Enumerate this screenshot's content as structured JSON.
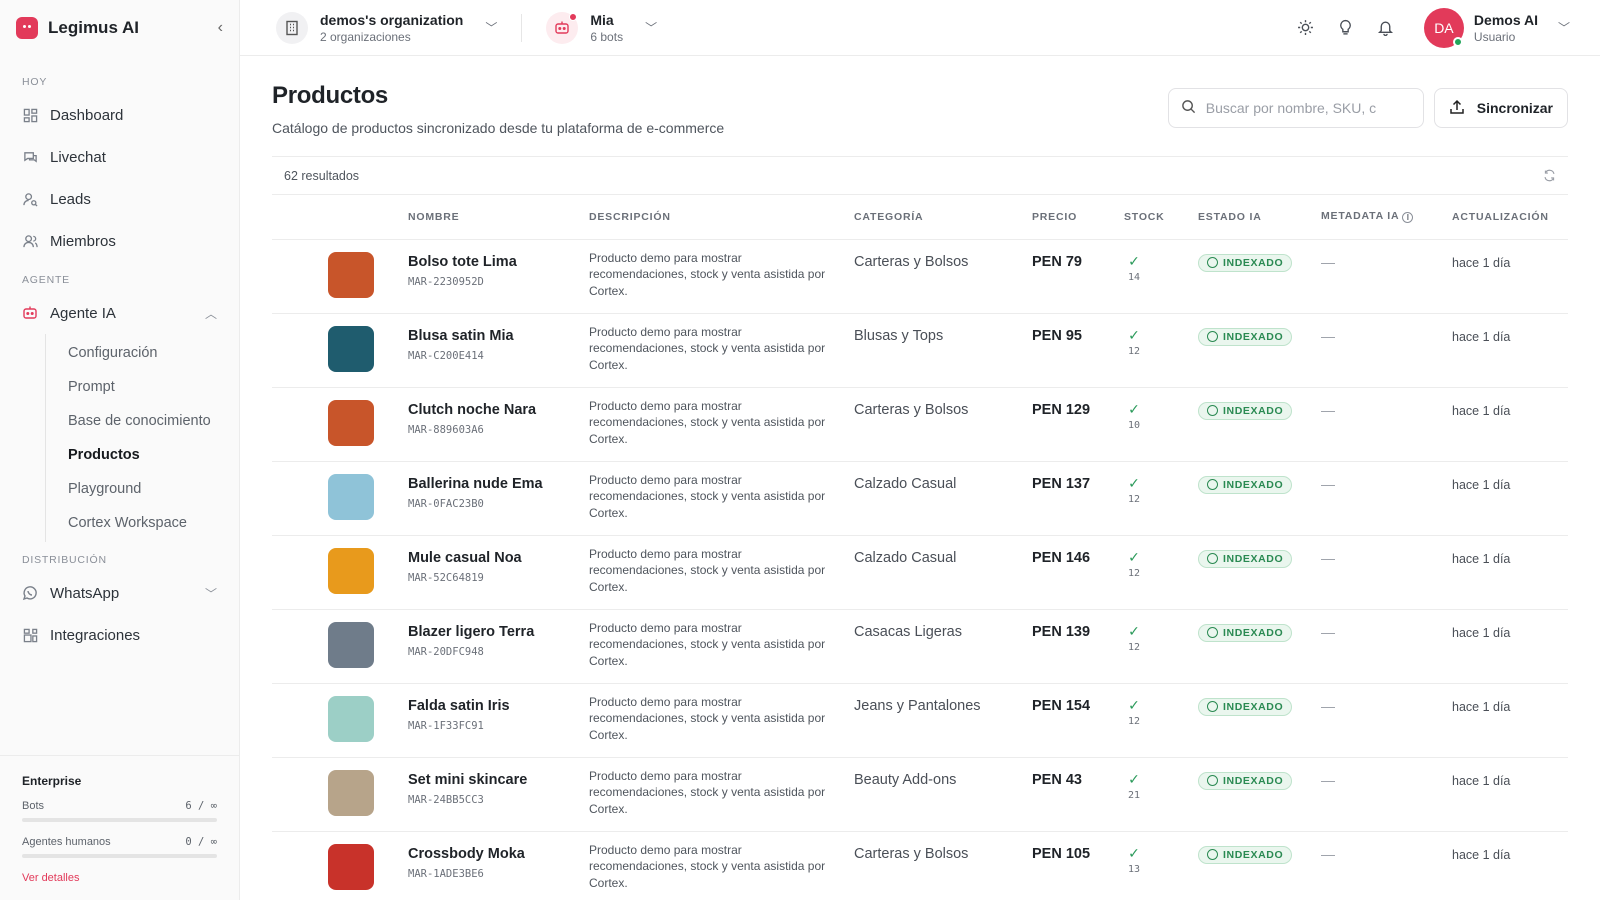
{
  "brand": {
    "name": "Legimus AI",
    "accent": "#e23a5a"
  },
  "sidebar": {
    "sections": {
      "hoy": "HOY",
      "agente": "AGENTE",
      "distribucion": "DISTRIBUCIÓN"
    },
    "items": {
      "dashboard": "Dashboard",
      "livechat": "Livechat",
      "leads": "Leads",
      "miembros": "Miembros",
      "agente_ia": "Agente IA",
      "whatsapp": "WhatsApp",
      "integraciones": "Integraciones"
    },
    "subitems": [
      "Configuración",
      "Prompt",
      "Base de conocimiento",
      "Productos",
      "Playground",
      "Cortex Workspace"
    ],
    "active_subitem": "Productos",
    "plan": {
      "title": "Enterprise",
      "bots_label": "Bots",
      "bots_value": "6 / ∞",
      "agents_label": "Agentes humanos",
      "agents_value": "0 / ∞",
      "details_link": "Ver detalles"
    }
  },
  "topbar": {
    "org": {
      "title": "demos's organization",
      "subtitle": "2 organizaciones"
    },
    "bot": {
      "title": "Mia",
      "subtitle": "6 bots"
    },
    "user": {
      "initials": "DA",
      "name": "Demos AI",
      "role": "Usuario"
    }
  },
  "page": {
    "title": "Productos",
    "subtitle": "Catálogo de productos sincronizado desde tu plataforma de e-commerce",
    "search_placeholder": "Buscar por nombre, SKU, c",
    "sync_label": "Sincronizar",
    "results": "62 resultados"
  },
  "table": {
    "headers": {
      "nombre": "NOMBRE",
      "descripcion": "DESCRIPCIÓN",
      "categoria": "CATEGORÍA",
      "precio": "PRECIO",
      "stock": "STOCK",
      "estado": "ESTADO IA",
      "metadata": "METADATA IA",
      "actualizacion": "ACTUALIZACIÓN"
    },
    "rows": [
      {
        "name": "Bolso tote Lima",
        "sku": "MAR-2230952D",
        "desc": "Producto demo para mostrar recomendaciones, stock y venta asistida por Cortex.",
        "category": "Carteras y Bolsos",
        "price": "PEN 79",
        "stock": "14",
        "status": "INDEXADO",
        "metadata": "—",
        "updated": "hace 1 día",
        "thumb": "#c8552a"
      },
      {
        "name": "Blusa satin Mia",
        "sku": "MAR-C200E414",
        "desc": "Producto demo para mostrar recomendaciones, stock y venta asistida por Cortex.",
        "category": "Blusas y Tops",
        "price": "PEN 95",
        "stock": "12",
        "status": "INDEXADO",
        "metadata": "—",
        "updated": "hace 1 día",
        "thumb": "#1f5c6e"
      },
      {
        "name": "Clutch noche Nara",
        "sku": "MAR-889603A6",
        "desc": "Producto demo para mostrar recomendaciones, stock y venta asistida por Cortex.",
        "category": "Carteras y Bolsos",
        "price": "PEN 129",
        "stock": "10",
        "status": "INDEXADO",
        "metadata": "—",
        "updated": "hace 1 día",
        "thumb": "#c8552a"
      },
      {
        "name": "Ballerina nude Ema",
        "sku": "MAR-0FAC23B0",
        "desc": "Producto demo para mostrar recomendaciones, stock y venta asistida por Cortex.",
        "category": "Calzado Casual",
        "price": "PEN 137",
        "stock": "12",
        "status": "INDEXADO",
        "metadata": "—",
        "updated": "hace 1 día",
        "thumb": "#8fc3d8"
      },
      {
        "name": "Mule casual Noa",
        "sku": "MAR-52C64819",
        "desc": "Producto demo para mostrar recomendaciones, stock y venta asistida por Cortex.",
        "category": "Calzado Casual",
        "price": "PEN 146",
        "stock": "12",
        "status": "INDEXADO",
        "metadata": "—",
        "updated": "hace 1 día",
        "thumb": "#e89a1c"
      },
      {
        "name": "Blazer ligero Terra",
        "sku": "MAR-20DFC948",
        "desc": "Producto demo para mostrar recomendaciones, stock y venta asistida por Cortex.",
        "category": "Casacas Ligeras",
        "price": "PEN 139",
        "stock": "12",
        "status": "INDEXADO",
        "metadata": "—",
        "updated": "hace 1 día",
        "thumb": "#6f7c8a"
      },
      {
        "name": "Falda satin Iris",
        "sku": "MAR-1F33FC91",
        "desc": "Producto demo para mostrar recomendaciones, stock y venta asistida por Cortex.",
        "category": "Jeans y Pantalones",
        "price": "PEN 154",
        "stock": "12",
        "status": "INDEXADO",
        "metadata": "—",
        "updated": "hace 1 día",
        "thumb": "#9ccfc6"
      },
      {
        "name": "Set mini skincare",
        "sku": "MAR-24BB5CC3",
        "desc": "Producto demo para mostrar recomendaciones, stock y venta asistida por Cortex.",
        "category": "Beauty Add-ons",
        "price": "PEN 43",
        "stock": "21",
        "status": "INDEXADO",
        "metadata": "—",
        "updated": "hace 1 día",
        "thumb": "#b7a48a"
      },
      {
        "name": "Crossbody Moka",
        "sku": "MAR-1ADE3BE6",
        "desc": "Producto demo para mostrar recomendaciones, stock y venta asistida por Cortex.",
        "category": "Carteras y Bolsos",
        "price": "PEN 105",
        "stock": "13",
        "status": "INDEXADO",
        "metadata": "—",
        "updated": "hace 1 día",
        "thumb": "#c8322a"
      }
    ]
  }
}
